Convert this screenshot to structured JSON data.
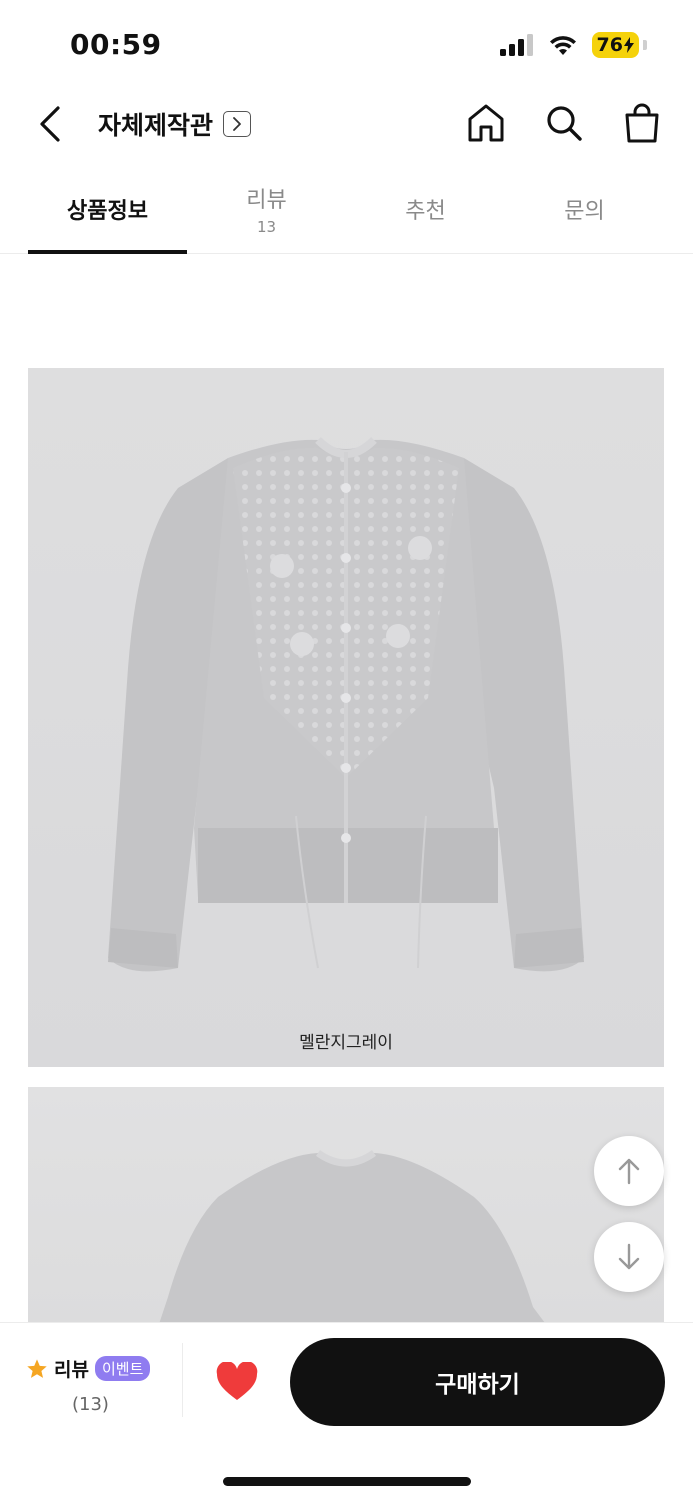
{
  "status": {
    "time": "00:59",
    "battery": "76"
  },
  "header": {
    "title": "자체제작관"
  },
  "tabs": [
    {
      "label": "상품정보",
      "count": ""
    },
    {
      "label": "리뷰",
      "count": "13"
    },
    {
      "label": "추천",
      "count": ""
    },
    {
      "label": "문의",
      "count": ""
    }
  ],
  "product": {
    "caption": "멜란지그레이"
  },
  "bottom": {
    "review_label": "리뷰",
    "event_badge": "이벤트",
    "review_count": "(13)",
    "buy_label": "구매하기"
  },
  "colors": {
    "accent": "#111111",
    "heart": "#ef3b3b",
    "badge": "#8f7cf0",
    "star": "#f5a623",
    "battery": "#f5d20b"
  }
}
